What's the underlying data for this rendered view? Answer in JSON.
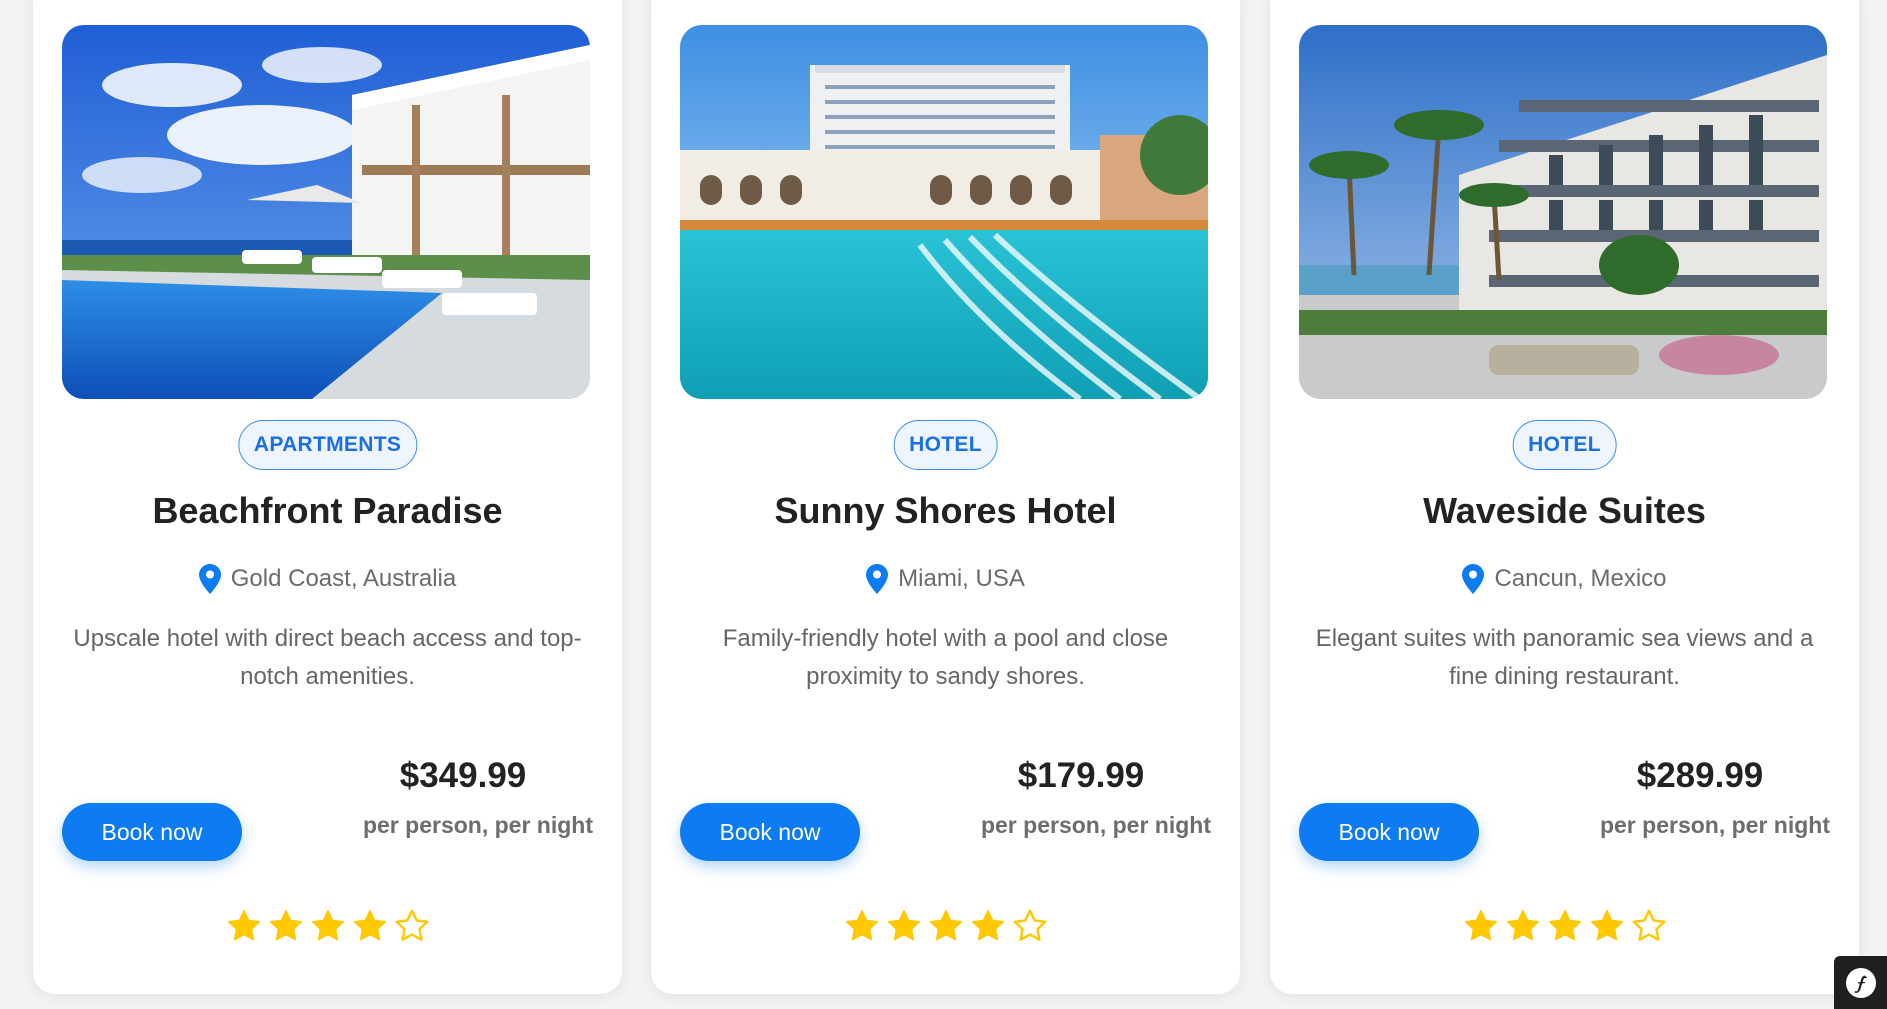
{
  "colors": {
    "accent": "#0d7bf3",
    "star": "#ffc800",
    "pin": "#0d7bf3"
  },
  "cards": [
    {
      "category": "APARTMENTS",
      "title": "Beachfront Paradise",
      "location": "Gold Coast, Australia",
      "description": "Upscale hotel with direct beach access and top-notch amenities.",
      "button_label": "Book now",
      "price": "$349.99",
      "price_unit": "per person, per night",
      "rating": 4,
      "rating_max": 5
    },
    {
      "category": "HOTEL",
      "title": "Sunny Shores Hotel",
      "location": "Miami, USA",
      "description": "Family-friendly hotel with a pool and close proximity to sandy shores.",
      "button_label": "Book now",
      "price": "$179.99",
      "price_unit": "per person, per night",
      "rating": 4,
      "rating_max": 5
    },
    {
      "category": "HOTEL",
      "title": "Waveside Suites",
      "location": "Cancun, Mexico",
      "description": "Elegant suites with panoramic sea views and a fine dining restaurant.",
      "button_label": "Book now",
      "price": "$289.99",
      "price_unit": "per person, per night",
      "rating": 4,
      "rating_max": 5
    }
  ],
  "icons": {
    "location": "map-pin-icon",
    "star_filled": "star-filled-icon",
    "star_empty": "star-outline-icon",
    "debug_toolbar": "symfony-logo-icon"
  }
}
